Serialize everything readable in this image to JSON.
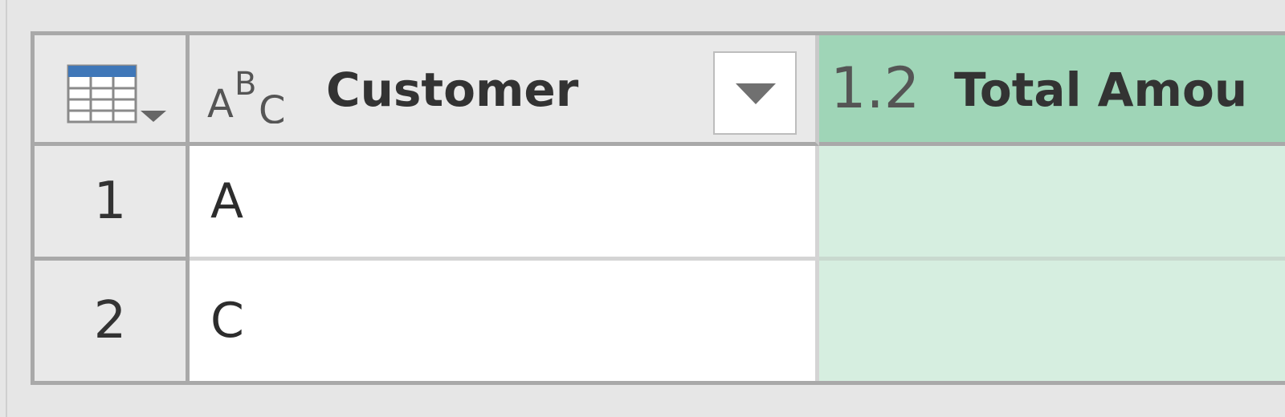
{
  "table": {
    "columns": [
      {
        "type_glyph": "ABC",
        "label": "Customer",
        "has_dropdown": true
      },
      {
        "type_glyph": "1.2",
        "label": "Total Amou",
        "selected": true
      }
    ],
    "rows": [
      {
        "index": "1",
        "customer": "A"
      },
      {
        "index": "2",
        "customer": "C"
      }
    ]
  },
  "colors": {
    "selected_header": "#9fd5b7",
    "selected_cell": "#d6eee0",
    "header_bg": "#e9e9e9",
    "grid_border": "#a9a9a9",
    "table_icon_accent": "#3f77b8"
  },
  "icons": {
    "corner": "table-menu-icon",
    "customer_type": "text-type-icon",
    "customer_dropdown": "dropdown-arrow-icon"
  }
}
